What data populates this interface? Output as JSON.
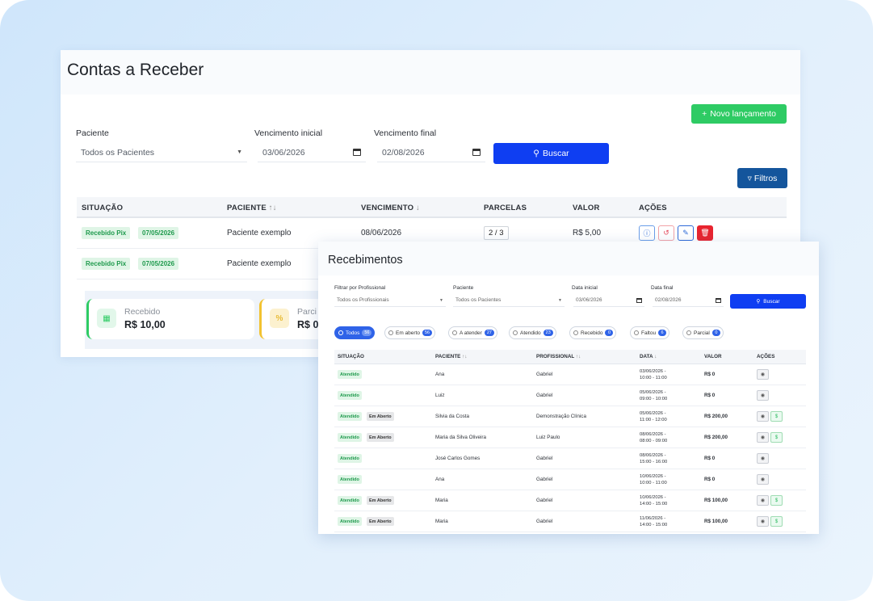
{
  "contas": {
    "title": "Contas a Receber",
    "novo_label": "Novo lançamento",
    "filters": {
      "paciente_label": "Paciente",
      "paciente_value": "Todos os Pacientes",
      "venc_inicial_label": "Vencimento inicial",
      "venc_inicial_value": "03/06/2026",
      "venc_final_label": "Vencimento final",
      "venc_final_value": "02/08/2026",
      "buscar_label": "Buscar",
      "filtros_label": "Filtros"
    },
    "columns": [
      "SITUAÇÃO",
      "PACIENTE",
      "VENCIMENTO",
      "PARCELAS",
      "VALOR",
      "AÇÕES"
    ],
    "rows": [
      {
        "status": "Recebido Pix",
        "date": "07/05/2026",
        "paciente": "Paciente exemplo",
        "vencimento": "08/06/2026",
        "parcelas": "2 / 3",
        "valor": "R$ 5,00"
      },
      {
        "status": "Recebido Pix",
        "date": "07/05/2026",
        "paciente": "Paciente exemplo"
      }
    ],
    "summary": [
      {
        "label": "Recebido",
        "value": "R$ 10,00",
        "icon": "calendar-icon",
        "color": "#2ecb64"
      },
      {
        "label": "Parci",
        "value": "R$ 0",
        "icon": "percent-icon",
        "color": "#f2c230"
      }
    ]
  },
  "recebimentos": {
    "title": "Recebimentos",
    "filters": {
      "profissional_label": "Filtrar por Profissional",
      "profissional_value": "Todos os Profissionais",
      "paciente_label": "Paciente",
      "paciente_value": "Todos os Pacientes",
      "data_inicial_label": "Data inicial",
      "data_inicial_value": "03/06/2026",
      "data_final_label": "Data final",
      "data_final_value": "02/08/2026",
      "buscar_label": "Buscar"
    },
    "chips": [
      {
        "label": "Todos",
        "count": "56",
        "active": true
      },
      {
        "label": "Em aberto",
        "count": "56"
      },
      {
        "label": "A atender",
        "count": "27"
      },
      {
        "label": "Atendido",
        "count": "23"
      },
      {
        "label": "Recebido",
        "count": "0"
      },
      {
        "label": "Faltou",
        "count": "6"
      },
      {
        "label": "Parcial",
        "count": "0"
      }
    ],
    "columns": [
      "SITUAÇÃO",
      "PACIENTE",
      "PROFISSIONAL",
      "DATA",
      "VALOR",
      "AÇÕES"
    ],
    "rows": [
      {
        "status": "Atendido",
        "extra": "",
        "paciente": "Ana",
        "profissional": "Gabriel",
        "data1": "03/06/2026 -",
        "data2": "10:00 - 11:00",
        "valor": "R$ 0"
      },
      {
        "status": "Atendido",
        "extra": "",
        "paciente": "Luiz",
        "profissional": "Gabriel",
        "data1": "05/06/2026 -",
        "data2": "09:00 - 10:00",
        "valor": "R$ 0"
      },
      {
        "status": "Atendido",
        "extra": "Em Aberto",
        "paciente": "Silvia da Costa",
        "profissional": "Demonstração Clínica",
        "data1": "05/06/2026 -",
        "data2": "11:00 - 12:00",
        "valor": "R$ 200,00"
      },
      {
        "status": "Atendido",
        "extra": "Em Aberto",
        "paciente": "Maria da Silva Oliveira",
        "profissional": "Luiz Paulo",
        "data1": "08/06/2026 -",
        "data2": "08:00 - 09:00",
        "valor": "R$ 200,00"
      },
      {
        "status": "Atendido",
        "extra": "",
        "paciente": "José Carlos Gomes",
        "profissional": "Gabriel",
        "data1": "08/06/2026 -",
        "data2": "15:00 - 16:00",
        "valor": "R$ 0"
      },
      {
        "status": "Atendido",
        "extra": "",
        "paciente": "Ana",
        "profissional": "Gabriel",
        "data1": "10/06/2026 -",
        "data2": "10:00 - 11:00",
        "valor": "R$ 0"
      },
      {
        "status": "Atendido",
        "extra": "Em Aberto",
        "paciente": "Maria",
        "profissional": "Gabriel",
        "data1": "10/06/2026 -",
        "data2": "14:00 - 15:00",
        "valor": "R$ 100,00"
      },
      {
        "status": "Atendido",
        "extra": "Em Aberto",
        "paciente": "Maria",
        "profissional": "Gabriel",
        "data1": "11/06/2026 -",
        "data2": "14:00 - 15:00",
        "valor": "R$ 100,00"
      }
    ]
  }
}
